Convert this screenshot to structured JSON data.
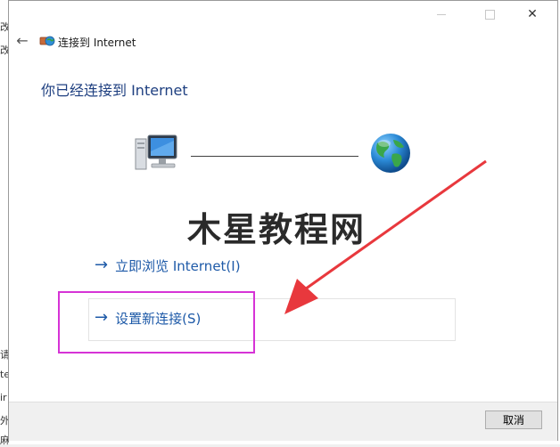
{
  "background_fragments": [
    "改",
    "改",
    "请",
    "te",
    "ir",
    "外",
    "麻组"
  ],
  "window": {
    "title": "连接到 Internet",
    "minimize_icon": "minimize-icon",
    "maximize_icon": "maximize-icon",
    "close_glyph": "✕"
  },
  "nav": {
    "back_glyph": "←"
  },
  "content": {
    "heading": "你已经连接到 Internet",
    "watermark": "木星教程网"
  },
  "links": {
    "arrow_glyph": "→",
    "browse_now": "立即浏览 Internet(I)",
    "setup_new": "设置新连接(S)"
  },
  "footer": {
    "cancel": "取消"
  },
  "colors": {
    "link": "#1e5aa8",
    "heading": "#1e3f80",
    "highlight": "#d633d6",
    "annotation_arrow": "#e8383d"
  }
}
